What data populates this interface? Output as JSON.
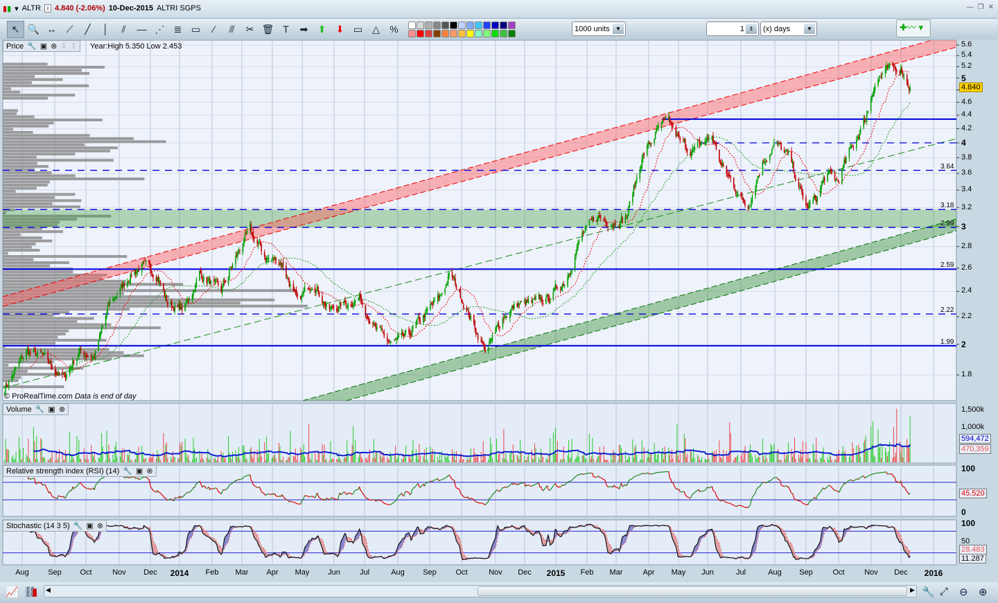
{
  "title": {
    "symbol": "ALTR",
    "price_change": "4.840 (-2.06%)",
    "date": "10-Dec-2015",
    "name": "ALTRI SGPS"
  },
  "toolbar": {
    "tools": [
      {
        "name": "pointer",
        "g": "↖"
      },
      {
        "name": "zoom",
        "g": "🔍"
      },
      {
        "name": "horizontal-measure",
        "g": "↔"
      },
      {
        "name": "segment",
        "g": "⟋"
      },
      {
        "name": "trend-line",
        "g": "╱"
      },
      {
        "name": "vertical-line",
        "g": "│"
      },
      {
        "name": "channel",
        "g": "⫽"
      },
      {
        "name": "horizontal-line",
        "g": "—"
      },
      {
        "name": "fan",
        "g": "⋰"
      },
      {
        "name": "fibonacci",
        "g": "≣"
      },
      {
        "name": "ruler",
        "g": "▭"
      },
      {
        "name": "points",
        "g": "⁄"
      },
      {
        "name": "parallel",
        "g": "⫻"
      },
      {
        "name": "tools",
        "g": "✂"
      },
      {
        "name": "trash",
        "g": "🗑"
      },
      {
        "name": "text",
        "g": "T"
      },
      {
        "name": "arrow-right",
        "g": "➡"
      },
      {
        "name": "arrow-up",
        "g": "⬆"
      },
      {
        "name": "arrow-down",
        "g": "⬇"
      },
      {
        "name": "rectangle",
        "g": "▭"
      },
      {
        "name": "triangle",
        "g": "△"
      },
      {
        "name": "percent",
        "g": "%"
      }
    ],
    "colors_top": [
      "#ffffff",
      "#d8d8d8",
      "#b0b0b0",
      "#888888",
      "#555555",
      "#000000",
      "#c0d4ff",
      "#80aaff",
      "#40c8ff",
      "#2040ff",
      "#0000c0",
      "#000080",
      "#a040c0"
    ],
    "colors_bottom": [
      "#ff9090",
      "#ff0000",
      "#e04040",
      "#804000",
      "#ff8040",
      "#ff9966",
      "#ffc040",
      "#ffff00",
      "#80ffc0",
      "#80ff80",
      "#00e000",
      "#40c040",
      "#008000"
    ],
    "units": "1000 units",
    "period_value": "1",
    "period_unit": "(x) days"
  },
  "price_panel": {
    "label": "Price",
    "info": "Year:High 5.350 Low 2.453",
    "copyright": "© ProRealTime.com",
    "note": "Data is end of day",
    "last_price": "4.840",
    "y_ticks": [
      "5.6",
      "5.4",
      "5.2",
      "5",
      "4.8",
      "4.6",
      "4.4",
      "4.2",
      "4",
      "3.8",
      "3.6",
      "3.4",
      "3.2",
      "3",
      "2.8",
      "2.6",
      "2.4",
      "2.2",
      "2",
      "1.8"
    ],
    "levels": [
      "3.64",
      "3.18",
      "2.99",
      "2.59",
      "2.22",
      "1.99"
    ]
  },
  "volume_panel": {
    "label": "Volume",
    "ticks": [
      "1,500k",
      "1,000k"
    ],
    "ma_value": "594,472",
    "last_value": "470,359"
  },
  "rsi_panel": {
    "label": "Relative strength index (RSI) (14)",
    "ticks": [
      "100",
      "0"
    ],
    "value": "45.520"
  },
  "stoch_panel": {
    "label": "Stochastic (14 3 5)",
    "ticks": [
      "100",
      "50"
    ],
    "d_value": "28.483",
    "k_value": "11.287"
  },
  "x_axis": [
    {
      "l": "Aug",
      "b": false
    },
    {
      "l": "Sep",
      "b": false
    },
    {
      "l": "Oct",
      "b": false
    },
    {
      "l": "Nov",
      "b": false
    },
    {
      "l": "Dec",
      "b": false
    },
    {
      "l": "2014",
      "b": true
    },
    {
      "l": "Feb",
      "b": false
    },
    {
      "l": "Mar",
      "b": false
    },
    {
      "l": "Apr",
      "b": false
    },
    {
      "l": "May",
      "b": false
    },
    {
      "l": "Jun",
      "b": false
    },
    {
      "l": "Jul",
      "b": false
    },
    {
      "l": "Aug",
      "b": false
    },
    {
      "l": "Sep",
      "b": false
    },
    {
      "l": "Oct",
      "b": false
    },
    {
      "l": "Nov",
      "b": false
    },
    {
      "l": "Dec",
      "b": false
    },
    {
      "l": "2015",
      "b": true
    },
    {
      "l": "Feb",
      "b": false
    },
    {
      "l": "Mar",
      "b": false
    },
    {
      "l": "Apr",
      "b": false
    },
    {
      "l": "May",
      "b": false
    },
    {
      "l": "Jun",
      "b": false
    },
    {
      "l": "Jul",
      "b": false
    },
    {
      "l": "Aug",
      "b": false
    },
    {
      "l": "Sep",
      "b": false
    },
    {
      "l": "Oct",
      "b": false
    },
    {
      "l": "Nov",
      "b": false
    },
    {
      "l": "Dec",
      "b": false
    },
    {
      "l": "2016",
      "b": true
    }
  ],
  "chart_data": {
    "type": "candlestick",
    "y_scale": "log",
    "ylim": [
      1.7,
      5.7
    ],
    "close_path": [
      [
        "2013-07-15",
        1.72
      ],
      [
        "2013-08-05",
        1.95
      ],
      [
        "2013-08-20",
        1.92
      ],
      [
        "2013-09-10",
        1.78
      ],
      [
        "2013-09-25",
        1.95
      ],
      [
        "2013-10-10",
        1.92
      ],
      [
        "2013-10-25",
        2.3
      ],
      [
        "2013-11-15",
        2.55
      ],
      [
        "2013-11-25",
        2.62
      ],
      [
        "2013-12-10",
        2.55
      ],
      [
        "2013-12-20",
        2.3
      ],
      [
        "2014-01-05",
        2.25
      ],
      [
        "2014-01-20",
        2.55
      ],
      [
        "2014-02-10",
        2.4
      ],
      [
        "2014-03-01",
        2.8
      ],
      [
        "2014-03-10",
        2.95
      ],
      [
        "2014-03-25",
        2.7
      ],
      [
        "2014-04-10",
        2.65
      ],
      [
        "2014-04-25",
        2.3
      ],
      [
        "2014-05-10",
        2.5
      ],
      [
        "2014-05-25",
        2.25
      ],
      [
        "2014-06-10",
        2.3
      ],
      [
        "2014-06-25",
        2.35
      ],
      [
        "2014-07-10",
        2.1
      ],
      [
        "2014-07-25",
        2.0
      ],
      [
        "2014-08-10",
        2.05
      ],
      [
        "2014-08-25",
        2.2
      ],
      [
        "2014-09-10",
        2.35
      ],
      [
        "2014-09-20",
        2.55
      ],
      [
        "2014-10-01",
        2.35
      ],
      [
        "2014-10-15",
        2.1
      ],
      [
        "2014-10-25",
        1.95
      ],
      [
        "2014-11-10",
        2.2
      ],
      [
        "2014-11-25",
        2.3
      ],
      [
        "2014-12-10",
        2.3
      ],
      [
        "2014-12-25",
        2.35
      ],
      [
        "2015-01-10",
        2.5
      ],
      [
        "2015-01-25",
        2.9
      ],
      [
        "2015-02-10",
        3.1
      ],
      [
        "2015-02-25",
        3.05
      ],
      [
        "2015-03-10",
        3.1
      ],
      [
        "2015-03-25",
        3.8
      ],
      [
        "2015-04-10",
        4.2
      ],
      [
        "2015-04-20",
        4.3
      ],
      [
        "2015-05-01",
        4.0
      ],
      [
        "2015-05-15",
        3.9
      ],
      [
        "2015-06-01",
        4.1
      ],
      [
        "2015-06-10",
        3.7
      ],
      [
        "2015-06-25",
        3.4
      ],
      [
        "2015-07-05",
        3.2
      ],
      [
        "2015-07-20",
        3.75
      ],
      [
        "2015-08-01",
        4.0
      ],
      [
        "2015-08-15",
        3.8
      ],
      [
        "2015-08-25",
        3.4
      ],
      [
        "2015-09-01",
        3.2
      ],
      [
        "2015-09-10",
        3.3
      ],
      [
        "2015-09-20",
        3.6
      ],
      [
        "2015-10-01",
        3.5
      ],
      [
        "2015-10-10",
        3.8
      ],
      [
        "2015-10-20",
        4.1
      ],
      [
        "2015-10-28",
        4.35
      ],
      [
        "2015-11-05",
        4.9
      ],
      [
        "2015-11-15",
        5.1
      ],
      [
        "2015-11-25",
        5.15
      ],
      [
        "2015-12-01",
        5.2
      ],
      [
        "2015-12-10",
        4.84
      ]
    ],
    "horizontal_levels": [
      {
        "v": 4.34,
        "style": "solid"
      },
      {
        "v": 4.0,
        "style": "dashed"
      },
      {
        "v": 3.64,
        "style": "dashed"
      },
      {
        "v": 3.18,
        "style": "dashed"
      },
      {
        "v": 2.99,
        "style": "dashed"
      },
      {
        "v": 2.59,
        "style": "solid"
      },
      {
        "v": 2.22,
        "style": "dashed"
      },
      {
        "v": 1.99,
        "style": "solid"
      }
    ],
    "colors": {
      "up": "#00a000",
      "down": "#c00000",
      "channel_red": "#ff8080",
      "channel_green": "#40a040",
      "level": "#0000e0"
    }
  }
}
